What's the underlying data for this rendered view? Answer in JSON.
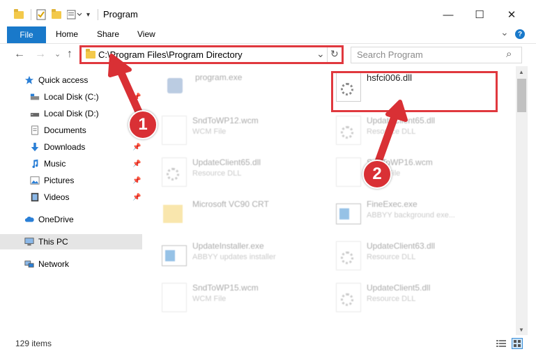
{
  "window": {
    "title": "Program",
    "minimize_glyph": "—",
    "maximize_glyph": "☐",
    "close_glyph": "✕"
  },
  "ribbon": {
    "tabs": [
      "File",
      "Home",
      "Share",
      "View"
    ],
    "expand_glyph": "⌄",
    "help_glyph": "?"
  },
  "nav": {
    "back_glyph": "←",
    "forward_glyph": "→",
    "recent_glyph": "⌄",
    "up_glyph": "↑",
    "address": "C:\\Program Files\\Program Directory",
    "refresh_glyph": "↻",
    "search_placeholder": "Search Program",
    "search_glyph": "⌕"
  },
  "sidebar": {
    "items": [
      {
        "label": "Quick access",
        "icon": "star-icon"
      },
      {
        "label": "Local Disk (C:)",
        "icon": "drive-icon"
      },
      {
        "label": "Local Disk (D:)",
        "icon": "drive-icon"
      },
      {
        "label": "Documents",
        "icon": "documents-icon"
      },
      {
        "label": "Downloads",
        "icon": "download-icon"
      },
      {
        "label": "Music",
        "icon": "music-icon"
      },
      {
        "label": "Pictures",
        "icon": "pictures-icon"
      },
      {
        "label": "Videos",
        "icon": "videos-icon"
      },
      {
        "label": "OneDrive",
        "icon": "cloud-icon"
      },
      {
        "label": "This PC",
        "icon": "computer-icon"
      },
      {
        "label": "Network",
        "icon": "network-icon"
      }
    ],
    "pin_glyph": "📌"
  },
  "files": [
    {
      "name": "program.exe",
      "type": ""
    },
    {
      "name": "hsfci006.dll",
      "type": ""
    },
    {
      "name": "SndToWP12.wcm",
      "type": "WCM File"
    },
    {
      "name": "UpdateClient65.dll",
      "type": "Resource DLL"
    },
    {
      "name": "UpdateClient65.dll",
      "type": "Resource DLL"
    },
    {
      "name": "SndToWP16.wcm",
      "type": "WCM File"
    },
    {
      "name": "Microsoft VC90 CRT",
      "type": ""
    },
    {
      "name": "FineExec.exe",
      "type": "ABBYY background exe..."
    },
    {
      "name": "UpdateInstaller.exe",
      "type": "ABBYY updates installer"
    },
    {
      "name": "UpdateClient63.dll",
      "type": "Resource DLL"
    },
    {
      "name": "SndToWP15.wcm",
      "type": "WCM File"
    },
    {
      "name": "UpdateClient5.dll",
      "type": "Resource DLL"
    }
  ],
  "status": {
    "count": "129 items"
  },
  "annotations": {
    "badge_1": "1",
    "badge_2": "2"
  },
  "colors": {
    "accent": "#1979ca",
    "highlight": "#e0383e",
    "badge": "#d93035"
  }
}
